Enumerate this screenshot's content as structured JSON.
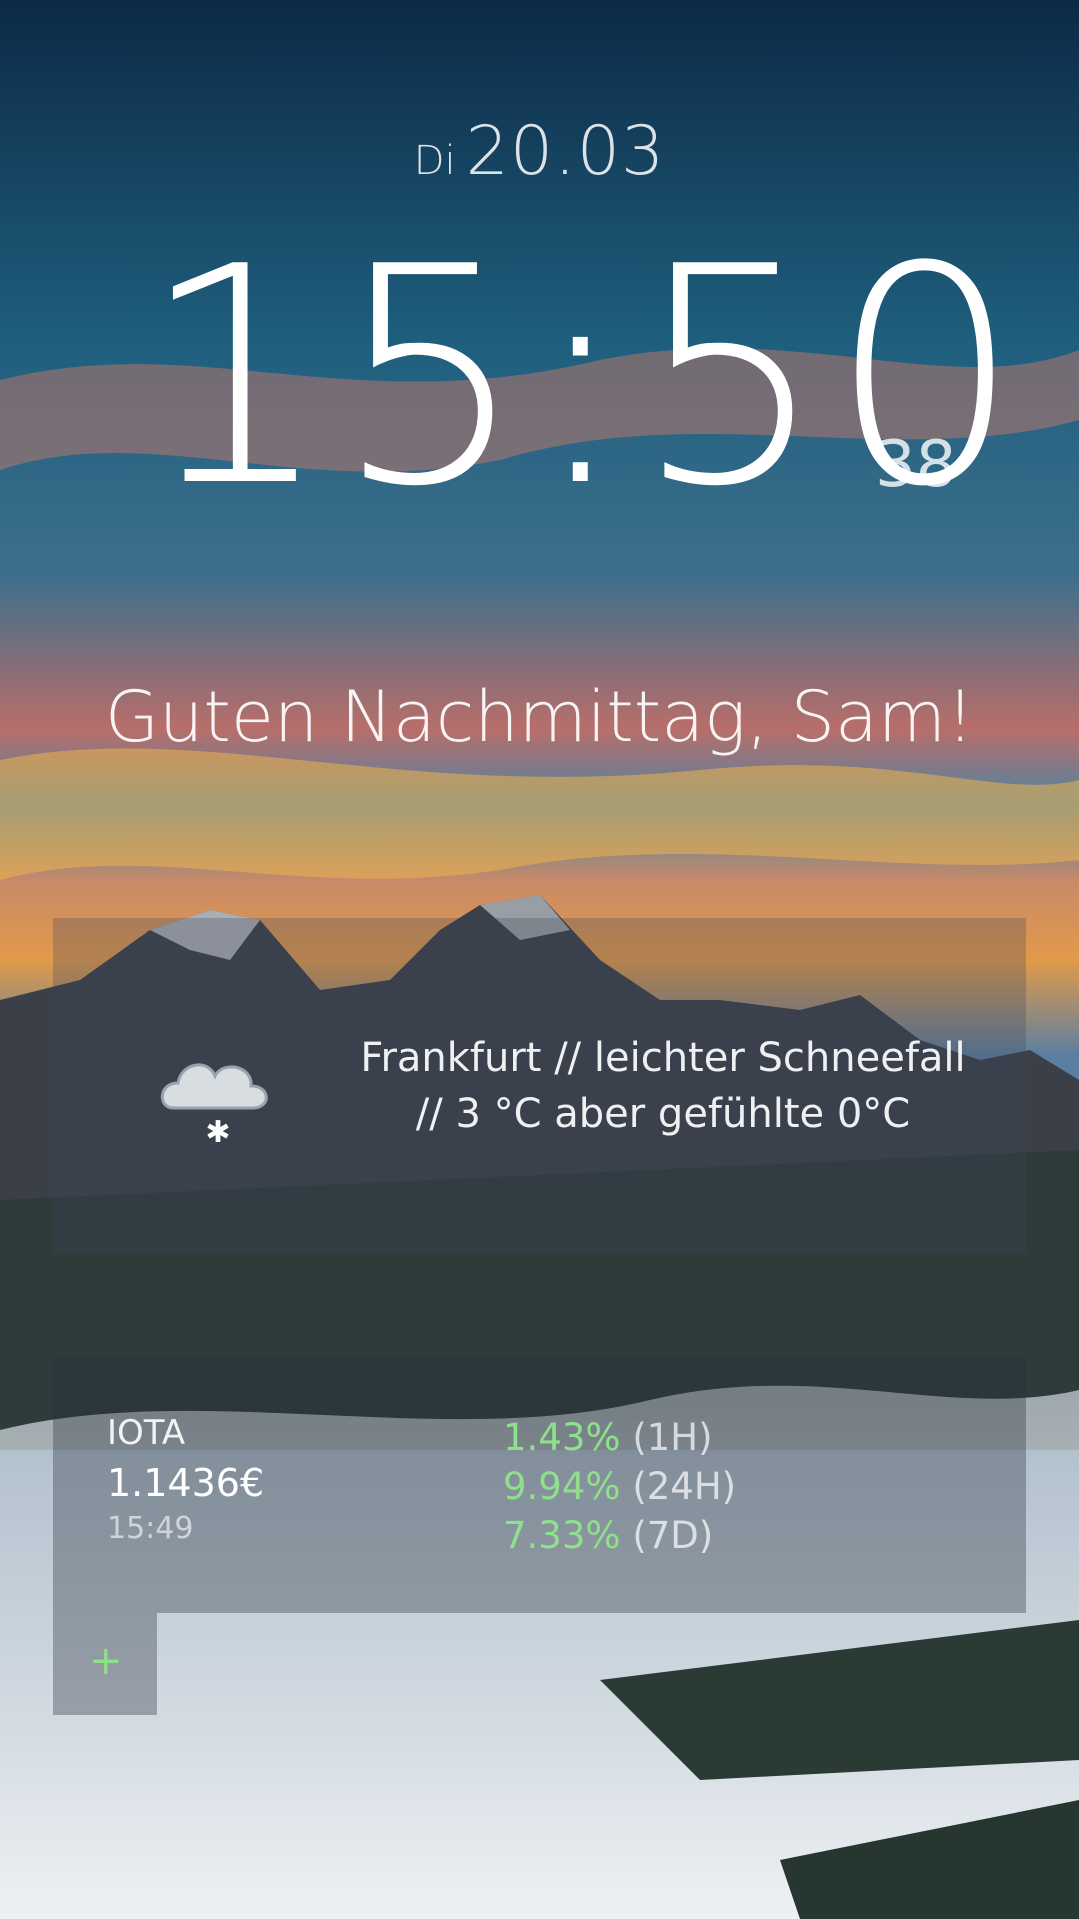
{
  "date": {
    "weekday": "Di",
    "day_month": "20.03"
  },
  "clock": {
    "hours_minutes": "15:50",
    "seconds": "38"
  },
  "greeting": "Guten Nachmittag, Sam!",
  "weather": {
    "icon": "cloud-snow-icon",
    "line1": "Frankfurt // leichter Schneefall",
    "line2": "// 3 °C aber gefühlte 0°C"
  },
  "crypto": {
    "name": "IOTA",
    "price": "1.1436€",
    "time": "15:49",
    "changes": [
      {
        "percent": "1.43%",
        "period": "(1H)"
      },
      {
        "percent": "9.94%",
        "period": "(24H)"
      },
      {
        "percent": "7.33%",
        "period": "(7D)"
      }
    ]
  },
  "add_button": {
    "label": "+"
  },
  "colors": {
    "positive": "#8fe08a",
    "text": "#ffffff"
  }
}
